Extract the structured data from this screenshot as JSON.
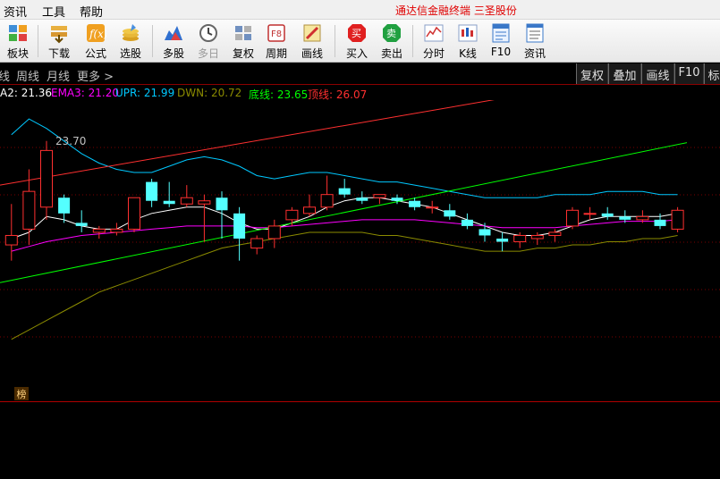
{
  "menu": {
    "items": [
      "资讯",
      "工具",
      "帮助"
    ],
    "app_title": "通达信金融终端   三圣股份"
  },
  "toolbar": {
    "buttons": [
      {
        "label": "板块",
        "icon": "sector-grid-icon"
      },
      {
        "label": "下载",
        "icon": "download-icon"
      },
      {
        "label": "公式",
        "icon": "formula-icon"
      },
      {
        "label": "选股",
        "icon": "stock-picker-icon"
      },
      {
        "label": "多股",
        "icon": "multi-stock-icon"
      },
      {
        "label": "多日",
        "icon": "multi-day-clock-icon"
      },
      {
        "label": "复权",
        "icon": "adjust-icon"
      },
      {
        "label": "周期",
        "icon": "period-f8-icon",
        "key": "F8"
      },
      {
        "label": "画线",
        "icon": "draw-line-icon"
      },
      {
        "label": "买入",
        "icon": "buy-icon",
        "badge": "买"
      },
      {
        "label": "卖出",
        "icon": "sell-icon",
        "badge": "卖"
      },
      {
        "label": "分时",
        "icon": "intraday-icon"
      },
      {
        "label": "K线",
        "icon": "kline-icon"
      },
      {
        "label": "F10",
        "icon": "f10-icon"
      },
      {
        "label": "资讯",
        "icon": "news-icon"
      }
    ]
  },
  "periods": {
    "items": [
      "线",
      "周线",
      "月线",
      "更多 >"
    ],
    "right_buttons": [
      "复权",
      "叠加",
      "画线",
      "F10",
      "标"
    ]
  },
  "legend": {
    "items": [
      {
        "text": "A2: 21.36",
        "color": "#ffffff"
      },
      {
        "text": "EMA3: 21.20",
        "color": "#ff00ff"
      },
      {
        "text": "UPR: 21.99",
        "color": "#00c8ff"
      },
      {
        "text": "DWN: 20.72",
        "color": "#8b8b00"
      },
      {
        "text": "底线: 23.65",
        "color": "#00ff00"
      },
      {
        "text": "顶线: 26.07",
        "color": "#ff3030"
      }
    ]
  },
  "chart_data": {
    "type": "candlestick",
    "ylim": [
      16.2,
      25.0
    ],
    "peak_label": "23.70",
    "candles": [
      {
        "o": 20.4,
        "h": 21.7,
        "l": 19.9,
        "c": 20.7
      },
      {
        "o": 20.9,
        "h": 22.8,
        "l": 20.4,
        "c": 22.1
      },
      {
        "o": 21.6,
        "h": 23.7,
        "l": 21.2,
        "c": 23.4
      },
      {
        "o": 21.9,
        "h": 22.0,
        "l": 21.1,
        "c": 21.4
      },
      {
        "o": 21.1,
        "h": 21.5,
        "l": 20.8,
        "c": 21.0
      },
      {
        "o": 20.8,
        "h": 21.0,
        "l": 20.6,
        "c": 20.9
      },
      {
        "o": 20.8,
        "h": 21.1,
        "l": 20.7,
        "c": 20.9
      },
      {
        "o": 20.9,
        "h": 21.7,
        "l": 20.8,
        "c": 21.9
      },
      {
        "o": 22.4,
        "h": 22.5,
        "l": 21.6,
        "c": 21.8
      },
      {
        "o": 21.8,
        "h": 22.4,
        "l": 21.6,
        "c": 21.7
      },
      {
        "o": 21.7,
        "h": 22.3,
        "l": 21.6,
        "c": 21.9
      },
      {
        "o": 21.7,
        "h": 22.0,
        "l": 20.5,
        "c": 21.8
      },
      {
        "o": 21.9,
        "h": 22.1,
        "l": 20.6,
        "c": 21.5
      },
      {
        "o": 21.4,
        "h": 21.6,
        "l": 19.9,
        "c": 20.6
      },
      {
        "o": 20.3,
        "h": 20.7,
        "l": 20.1,
        "c": 20.6
      },
      {
        "o": 20.6,
        "h": 21.2,
        "l": 20.3,
        "c": 21.0
      },
      {
        "o": 21.2,
        "h": 21.6,
        "l": 21.0,
        "c": 21.5
      },
      {
        "o": 21.4,
        "h": 22.0,
        "l": 21.3,
        "c": 21.6
      },
      {
        "o": 21.6,
        "h": 22.6,
        "l": 21.5,
        "c": 22.0
      },
      {
        "o": 22.2,
        "h": 22.5,
        "l": 21.9,
        "c": 22.0
      },
      {
        "o": 21.9,
        "h": 22.1,
        "l": 21.7,
        "c": 21.8
      },
      {
        "o": 21.9,
        "h": 22.0,
        "l": 21.7,
        "c": 22.0
      },
      {
        "o": 21.9,
        "h": 22.0,
        "l": 21.7,
        "c": 21.8
      },
      {
        "o": 21.8,
        "h": 21.9,
        "l": 21.5,
        "c": 21.6
      },
      {
        "o": 21.6,
        "h": 21.8,
        "l": 21.4,
        "c": 21.6
      },
      {
        "o": 21.5,
        "h": 21.7,
        "l": 21.2,
        "c": 21.3
      },
      {
        "o": 21.2,
        "h": 21.4,
        "l": 20.9,
        "c": 21.0
      },
      {
        "o": 20.9,
        "h": 21.1,
        "l": 20.5,
        "c": 20.7
      },
      {
        "o": 20.6,
        "h": 20.8,
        "l": 20.2,
        "c": 20.5
      },
      {
        "o": 20.5,
        "h": 20.8,
        "l": 20.3,
        "c": 20.7
      },
      {
        "o": 20.6,
        "h": 20.8,
        "l": 20.4,
        "c": 20.7
      },
      {
        "o": 20.7,
        "h": 20.9,
        "l": 20.5,
        "c": 20.8
      },
      {
        "o": 21.0,
        "h": 21.6,
        "l": 20.9,
        "c": 21.5
      },
      {
        "o": 21.4,
        "h": 21.6,
        "l": 21.2,
        "c": 21.4
      },
      {
        "o": 21.4,
        "h": 21.6,
        "l": 21.2,
        "c": 21.3
      },
      {
        "o": 21.3,
        "h": 21.5,
        "l": 21.1,
        "c": 21.2
      },
      {
        "o": 21.2,
        "h": 21.5,
        "l": 21.1,
        "c": 21.3
      },
      {
        "o": 21.2,
        "h": 21.4,
        "l": 20.9,
        "c": 21.0
      },
      {
        "o": 20.9,
        "h": 21.6,
        "l": 20.8,
        "c": 21.5
      }
    ],
    "bull_color": "#ff3030",
    "bear_color": "#54ffff",
    "lines": [
      {
        "name": "UPR",
        "color": "#00c8ff",
        "values": [
          23.9,
          24.4,
          24.1,
          23.7,
          23.3,
          23.0,
          22.8,
          22.7,
          22.7,
          22.9,
          23.1,
          23.2,
          23.1,
          22.9,
          22.6,
          22.5,
          22.6,
          22.7,
          22.7,
          22.6,
          22.5,
          22.4,
          22.4,
          22.3,
          22.2,
          22.1,
          22.0,
          21.9,
          21.9,
          21.9,
          21.9,
          22.0,
          22.0,
          22.0,
          22.1,
          22.1,
          22.1,
          22.0,
          22.0
        ]
      },
      {
        "name": "A2",
        "color": "#ffffff",
        "values": [
          20.6,
          20.8,
          21.3,
          21.2,
          21.0,
          20.9,
          20.9,
          21.2,
          21.4,
          21.5,
          21.6,
          21.6,
          21.4,
          21.1,
          20.9,
          20.9,
          21.1,
          21.3,
          21.6,
          21.8,
          21.9,
          21.9,
          21.8,
          21.7,
          21.6,
          21.4,
          21.2,
          21.0,
          20.8,
          20.7,
          20.7,
          20.8,
          21.0,
          21.2,
          21.3,
          21.3,
          21.3,
          21.3,
          21.4
        ]
      },
      {
        "name": "EMA3",
        "color": "#ff00ff",
        "values": [
          20.2,
          20.35,
          20.5,
          20.6,
          20.7,
          20.75,
          20.8,
          20.85,
          20.9,
          20.95,
          21.0,
          21.0,
          21.0,
          21.0,
          20.95,
          20.95,
          21.0,
          21.05,
          21.1,
          21.15,
          21.2,
          21.2,
          21.2,
          21.2,
          21.15,
          21.1,
          21.05,
          21.0,
          20.95,
          20.95,
          20.95,
          20.95,
          21.0,
          21.05,
          21.1,
          21.15,
          21.15,
          21.15,
          21.2
        ]
      },
      {
        "name": "DWN",
        "color": "#8b8b00",
        "values": [
          17.4,
          17.7,
          18.0,
          18.3,
          18.6,
          18.9,
          19.1,
          19.3,
          19.5,
          19.7,
          19.9,
          20.1,
          20.3,
          20.4,
          20.5,
          20.6,
          20.7,
          20.8,
          20.8,
          20.8,
          20.8,
          20.7,
          20.7,
          20.6,
          20.5,
          20.4,
          20.3,
          20.2,
          20.2,
          20.2,
          20.3,
          20.3,
          20.4,
          20.4,
          20.5,
          20.5,
          20.6,
          20.6,
          20.7
        ]
      },
      {
        "name": "底线",
        "color": "#00ff00",
        "values": [
          19.2,
          23.65
        ]
      },
      {
        "name": "顶线",
        "color": "#ff3030",
        "values": [
          22.3,
          26.07
        ]
      }
    ]
  }
}
